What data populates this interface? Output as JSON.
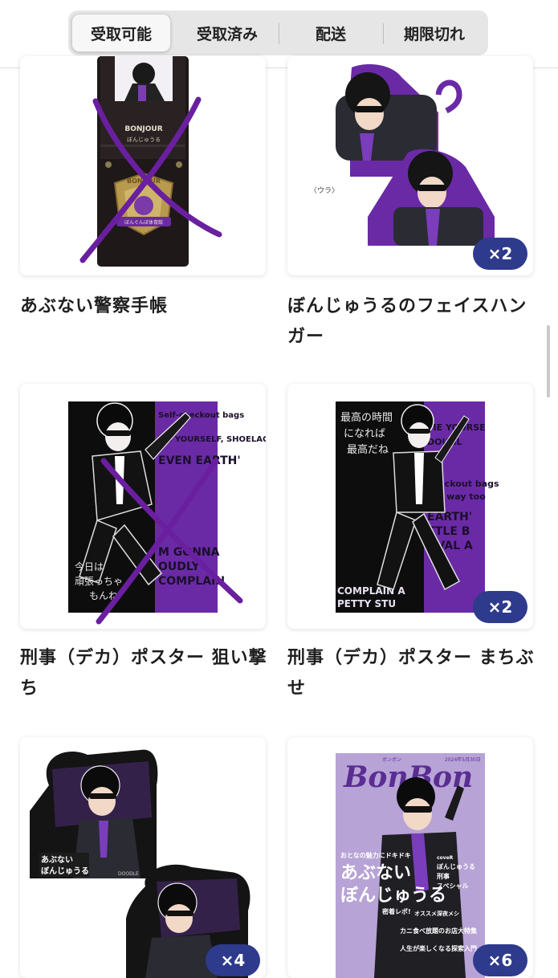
{
  "tabs": [
    {
      "label": "受取可能",
      "active": true
    },
    {
      "label": "受取済み",
      "active": false
    },
    {
      "label": "配送",
      "active": false
    },
    {
      "label": "期限切れ",
      "active": false
    }
  ],
  "items": [
    {
      "title": "あぶない警察手帳",
      "crossed_out": true,
      "image_text": {
        "header": "BONJOUR",
        "sub": "ぼんじゅうる",
        "badge_top": "BONJOUR",
        "badge_ribbon": "ぼんぐんぼ体育館"
      }
    },
    {
      "title": "ぼんじゅうるのフェイスハンガー",
      "quantity": "×2",
      "crossed_out": false,
      "image_text": {
        "caption": "〈ウラ〉"
      }
    },
    {
      "title": "刑事（デカ）ポスター 狙い撃ち",
      "crossed_out": true,
      "image_text": {
        "bg_lines": [
          "Self-checkout bags",
          "TIE YOURSELF, SHOELACE.",
          "EVEN EARTH'",
          "M GONNA",
          "OUDLY",
          "COMPLAIN"
        ],
        "note": [
          "今日は",
          "頑張っちゃ",
          "もんね"
        ]
      }
    },
    {
      "title": "刑事（デカ）ポスター まちぶせ",
      "quantity": "×2",
      "crossed_out": false,
      "image_text": {
        "bg_lines": [
          "TIE YOURSE",
          "DOUGL",
          "checkout bags",
          "are way too",
          "EARTH'",
          "TTLE B",
          "OVAL A",
          "COMPLAIN A",
          "PETTY STU"
        ],
        "note": [
          "最高の時間",
          "になれば",
          "最高だね"
        ]
      }
    },
    {
      "title": "",
      "quantity": "×4",
      "crossed_out": false,
      "image_text": {
        "logo": [
          "あぶない",
          "ぼんじゅうる"
        ],
        "small": "DOODLE"
      }
    },
    {
      "title": "",
      "quantity": "×6",
      "crossed_out": false,
      "image_text": {
        "magazine": "BonBon",
        "kana": "ボンボン",
        "issue": "2024年5月30日",
        "cover1": "おとなの魅力にドキドキ",
        "cover2": "あぶない",
        "cover3": "ぼんじゅうる",
        "side": [
          "coveR",
          "ぼんじゅうる",
          "刑事",
          "スペシャル"
        ],
        "list": [
          "オススメ深夜メシ",
          "カニ食べ放題のお店大特集",
          "人生が楽しくなる探索入門"
        ],
        "special": "密着レポ!"
      }
    }
  ],
  "colors": {
    "accent_badge": "#2e3a8c",
    "purple": "#6a2aa5",
    "cross": "#6a1fa0",
    "magazine_bg": "#b7a3d6"
  }
}
